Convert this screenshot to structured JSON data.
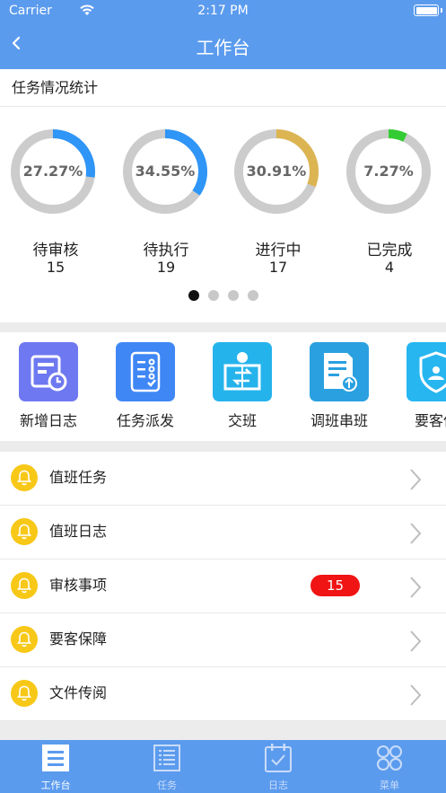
{
  "status_bar": {
    "carrier": "Carrier",
    "time": "2:17 PM"
  },
  "nav": {
    "title": "工作台"
  },
  "stats": {
    "heading": "任务情况统计",
    "items": [
      {
        "label": "待审核",
        "count": "15",
        "percent": "27.27%",
        "fraction": 0.2727,
        "color": "#2f95f7"
      },
      {
        "label": "待执行",
        "count": "19",
        "percent": "34.55%",
        "fraction": 0.3455,
        "color": "#2f95f7"
      },
      {
        "label": "进行中",
        "count": "17",
        "percent": "30.91%",
        "fraction": 0.3091,
        "color": "#dcb552"
      },
      {
        "label": "已完成",
        "count": "4",
        "percent": "7.27%",
        "fraction": 0.0727,
        "color": "#33cc33"
      }
    ],
    "ring_track_color": "#cccccc",
    "pager": {
      "pages": 4,
      "active": 1
    }
  },
  "shortcuts": [
    {
      "label": "新增日志",
      "icon": "log-add-icon",
      "color": "#6e78f0"
    },
    {
      "label": "任务派发",
      "icon": "task-dispatch-icon",
      "color": "#3f87f5"
    },
    {
      "label": "交班",
      "icon": "handover-icon",
      "color": "#25b3ec"
    },
    {
      "label": "调班串班",
      "icon": "shift-swap-icon",
      "color": "#2aa0e0"
    },
    {
      "label": "要客保",
      "icon": "vip-shield-icon",
      "color": "#27b6f0"
    }
  ],
  "list": [
    {
      "label": "值班任务",
      "icon": "bell-icon"
    },
    {
      "label": "值班日志",
      "icon": "bell-icon"
    },
    {
      "label": "审核事项",
      "icon": "bell-icon",
      "badge": "15"
    },
    {
      "label": "要客保障",
      "icon": "bell-icon"
    },
    {
      "label": "文件传阅",
      "icon": "bell-icon"
    }
  ],
  "tabs": [
    {
      "label": "工作台",
      "icon": "workbench-icon",
      "active": true
    },
    {
      "label": "任务",
      "icon": "task-list-icon",
      "active": false
    },
    {
      "label": "日志",
      "icon": "calendar-check-icon",
      "active": false
    },
    {
      "label": "菜单",
      "icon": "menu-grid-icon",
      "active": false
    }
  ],
  "colors": {
    "primary": "#5b9bee",
    "bell": "#f7c817",
    "badge": "#f01414"
  }
}
